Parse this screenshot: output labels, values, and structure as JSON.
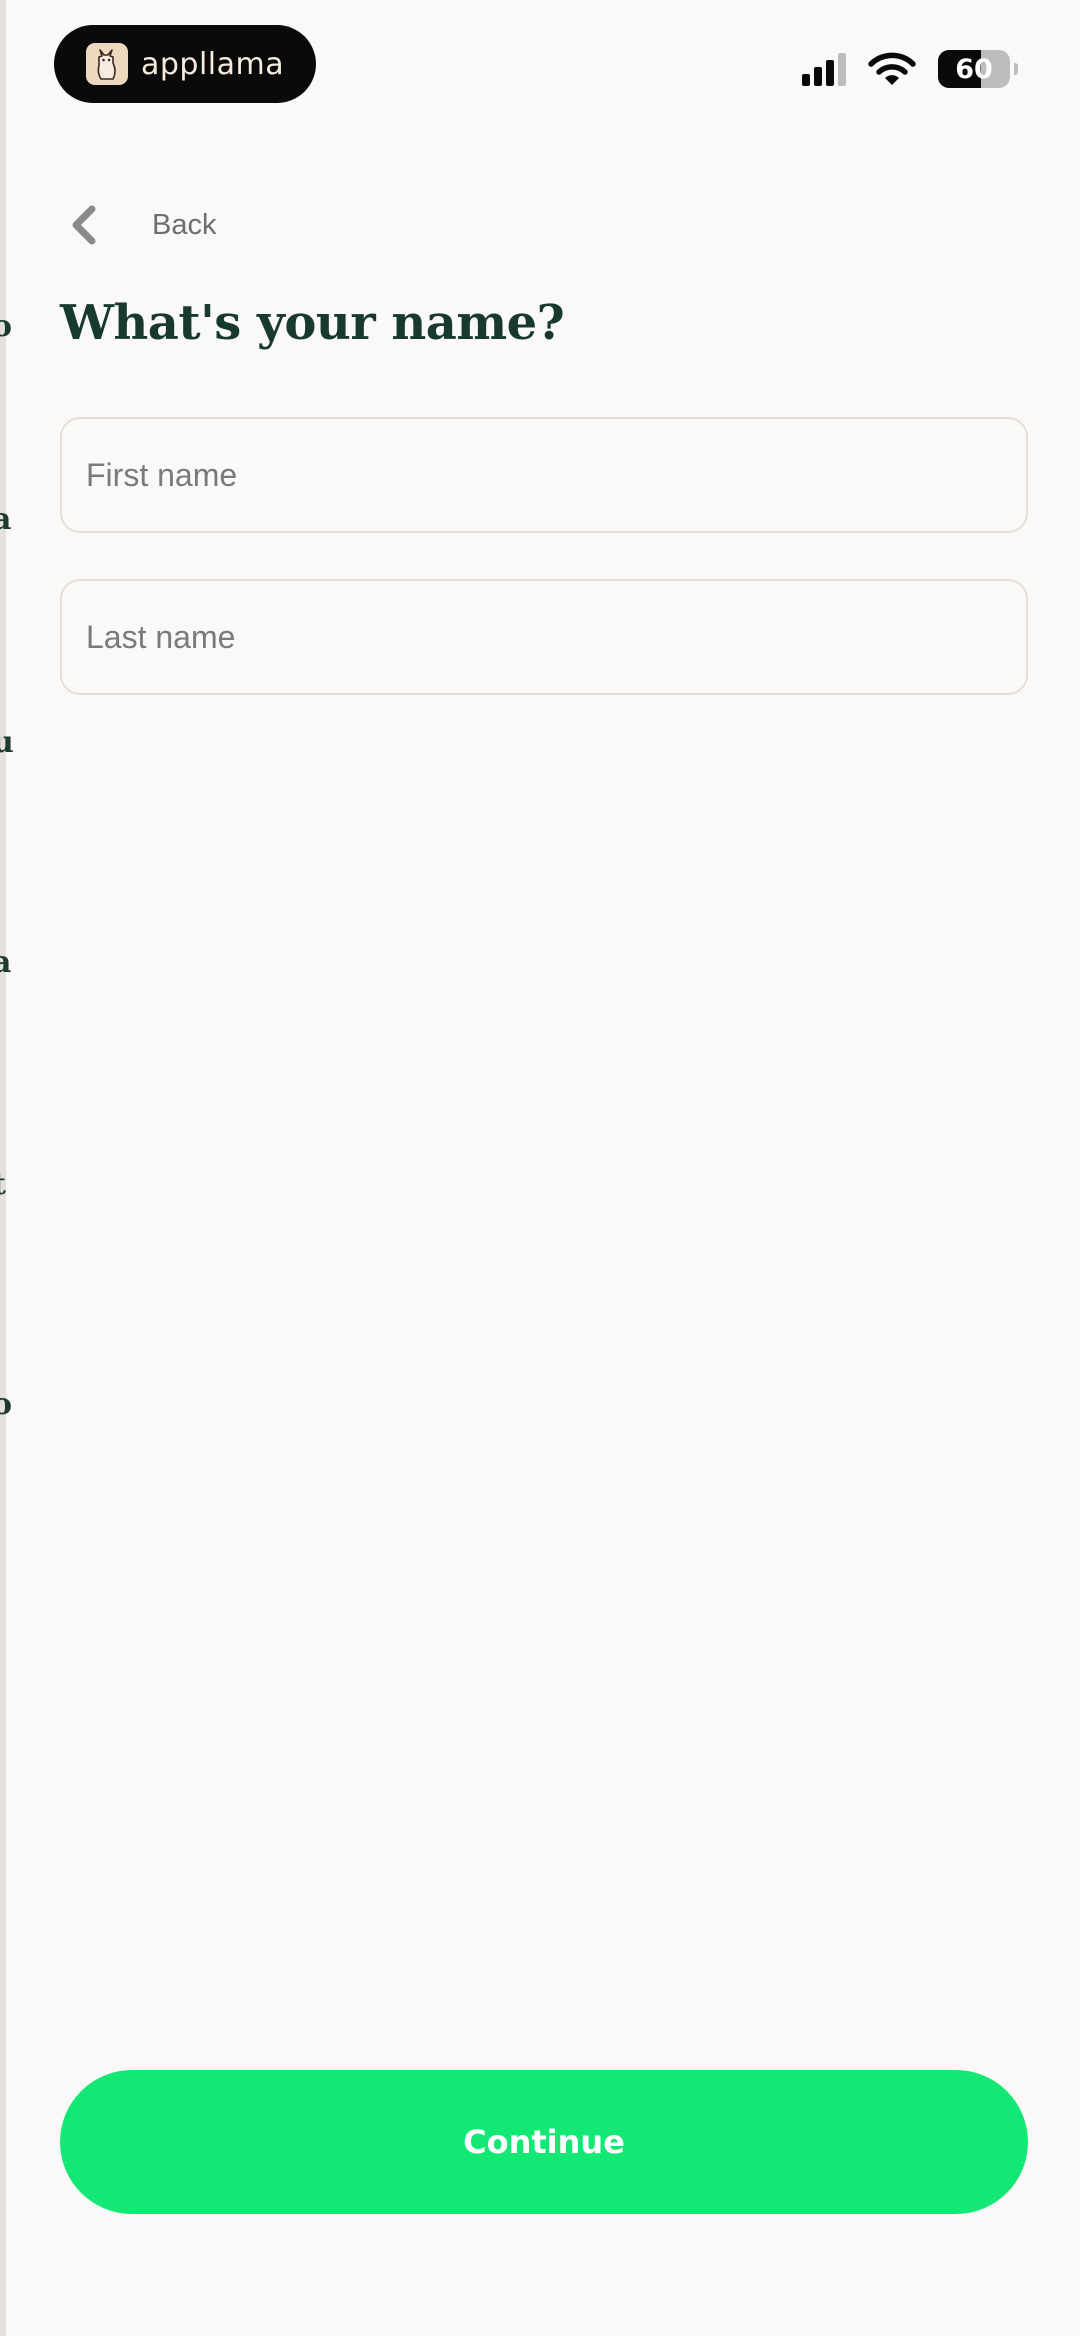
{
  "status_bar": {
    "app_name": "appllama",
    "battery_percent": "60",
    "battery_level": 0.6,
    "logo_icon": "llama-icon",
    "signal_icon": "cellular-signal-icon",
    "wifi_icon": "wifi-icon"
  },
  "nav": {
    "back_label": "Back",
    "back_icon": "chevron-left-icon"
  },
  "form": {
    "title": "What's your name?",
    "first_name": {
      "value": "",
      "placeholder": "First name"
    },
    "last_name": {
      "value": "",
      "placeholder": "Last name"
    }
  },
  "actions": {
    "continue_label": "Continue"
  },
  "colors": {
    "background": "#FBF9F7",
    "title": "#173A2C",
    "accent_green": "#14E874",
    "field_border": "#E3DFDB",
    "placeholder": "#7A7A7A"
  }
}
